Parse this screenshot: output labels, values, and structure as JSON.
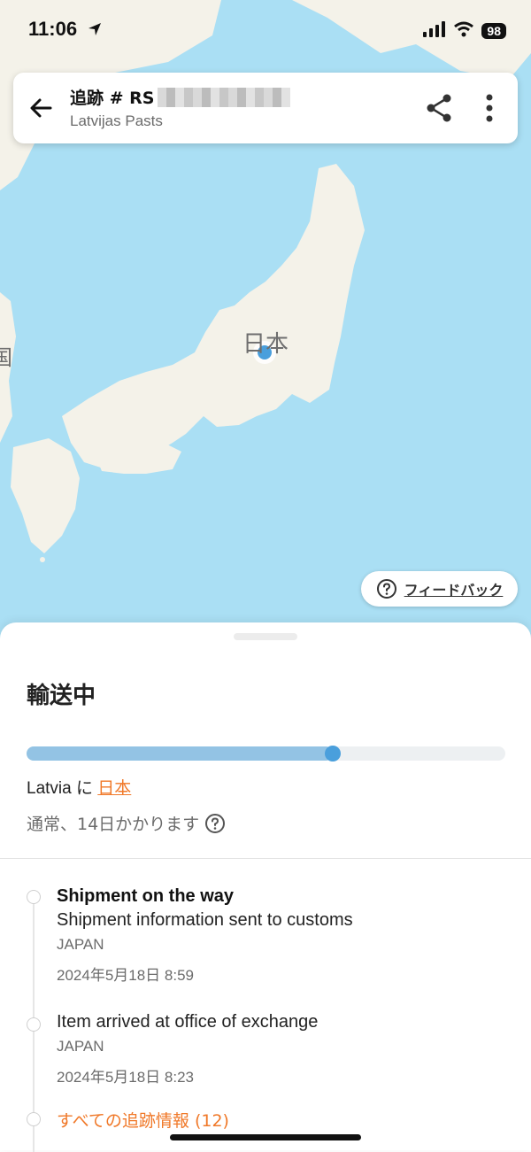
{
  "status_bar": {
    "time": "11:06",
    "battery": "98"
  },
  "header": {
    "title_prefix": "追跡 # RS",
    "carrier": "Latvijas Pasts"
  },
  "map": {
    "country_label": "日本",
    "partial_label": "国",
    "feedback_label": "フィードバック"
  },
  "sheet": {
    "status_title": "輸送中",
    "progress_percent": 64,
    "origin": "Latvia",
    "connector": " に ",
    "destination": "日本",
    "eta_text": "通常、14日かかります",
    "events": [
      {
        "title": "Shipment on the way",
        "description": "Shipment information sent to customs",
        "location": "JAPAN",
        "datetime": "2024年5月18日  8:59"
      },
      {
        "title": "",
        "description": "Item arrived at office of exchange",
        "location": "JAPAN",
        "datetime": "2024年5月18日  8:23"
      }
    ],
    "all_link": "すべての追跡情報 (12)"
  },
  "colors": {
    "accent": "#f07828",
    "progress": "#4a9fdc",
    "sea": "#aadff4",
    "land": "#f4f2e9"
  },
  "icons": [
    "back-arrow-icon",
    "share-icon",
    "more-vertical-icon",
    "help-circle-icon",
    "location-arrow-icon",
    "signal-icon",
    "wifi-icon"
  ]
}
